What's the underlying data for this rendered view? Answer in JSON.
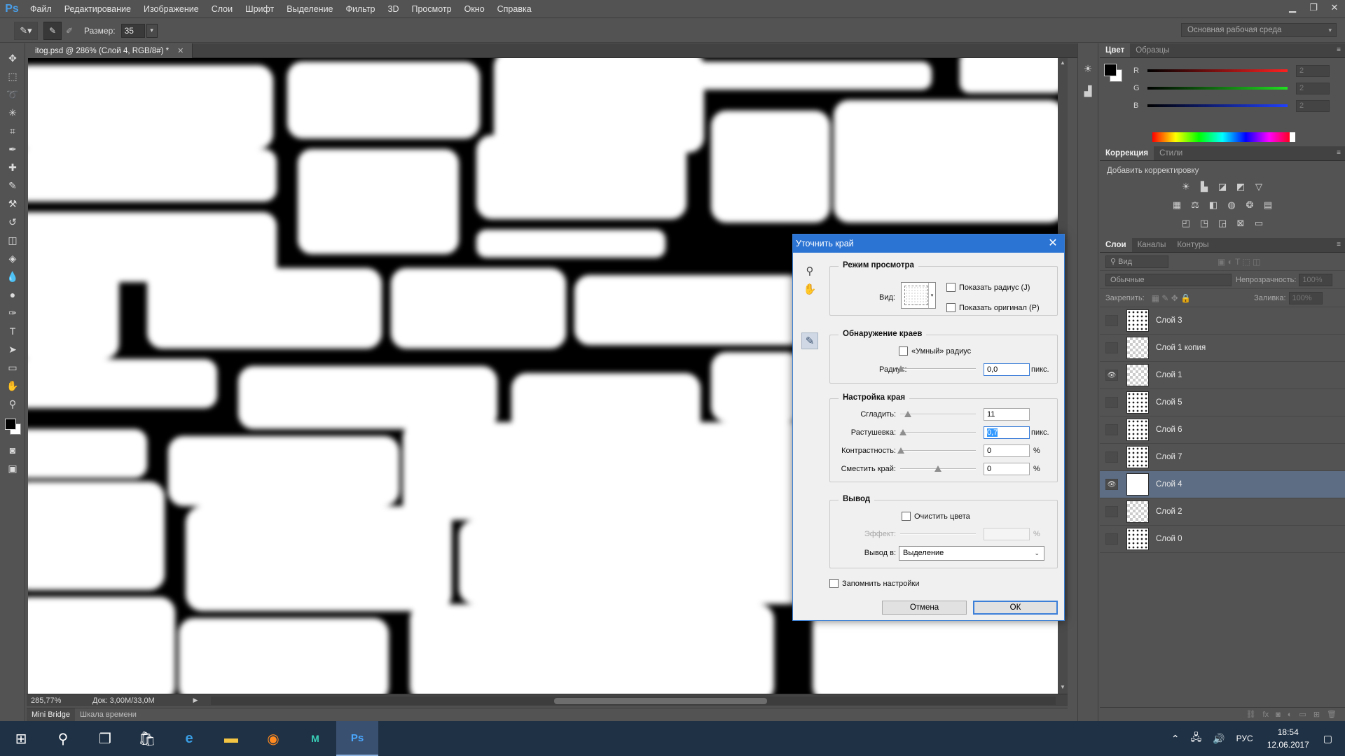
{
  "app": {
    "logo": "Ps"
  },
  "menu": [
    "Файл",
    "Редактирование",
    "Изображение",
    "Слои",
    "Шрифт",
    "Выделение",
    "Фильтр",
    "3D",
    "Просмотр",
    "Окно",
    "Справка"
  ],
  "options_bar": {
    "size_label": "Размер:",
    "size_value": "35",
    "workspace": "Основная рабочая среда"
  },
  "document": {
    "tab_title": "itog.psd @ 286% (Слой 4, RGB/8#) *",
    "zoom": "285,77%",
    "doc_info": "Док: 3,00M/33,0M"
  },
  "bottom_tabs": [
    "Mini Bridge",
    "Шкала времени"
  ],
  "color_panel": {
    "tabs": [
      "Цвет",
      "Образцы"
    ],
    "channels": [
      {
        "label": "R",
        "value": "2",
        "color": "#e62020"
      },
      {
        "label": "G",
        "value": "2",
        "color": "#20c020"
      },
      {
        "label": "B",
        "value": "2",
        "color": "#2040e0"
      }
    ]
  },
  "correction_panel": {
    "tabs": [
      "Коррекция",
      "Стили"
    ],
    "add_label": "Добавить корректировку"
  },
  "layers_panel": {
    "tabs": [
      "Слои",
      "Каналы",
      "Контуры"
    ],
    "filter_label": "Вид",
    "blend_mode": "Обычные",
    "opacity_label": "Непрозрачность:",
    "opacity_value": "100%",
    "lock_label": "Закрепить:",
    "fill_label": "Заливка:",
    "fill_value": "100%",
    "layers": [
      {
        "name": "Слой 3",
        "visible": false,
        "selected": false
      },
      {
        "name": "Слой 1 копия",
        "visible": false,
        "selected": false
      },
      {
        "name": "Слой 1",
        "visible": true,
        "selected": false
      },
      {
        "name": "Слой 5",
        "visible": false,
        "selected": false
      },
      {
        "name": "Слой 6",
        "visible": false,
        "selected": false
      },
      {
        "name": "Слой 7",
        "visible": false,
        "selected": false
      },
      {
        "name": "Слой 4",
        "visible": true,
        "selected": true
      },
      {
        "name": "Слой 2",
        "visible": false,
        "selected": false
      },
      {
        "name": "Слой 0",
        "visible": false,
        "selected": false
      }
    ]
  },
  "dialog": {
    "title": "Уточнить край",
    "view_mode": {
      "title": "Режим просмотра",
      "view_label": "Вид:",
      "show_radius": "Показать радиус (J)",
      "show_original": "Показать оригинал (P)"
    },
    "edge_detection": {
      "title": "Обнаружение краев",
      "smart_radius": "«Умный» радиус",
      "radius_label": "Радиус:",
      "radius_value": "0,0",
      "radius_unit": "пикс."
    },
    "adjust_edge": {
      "title": "Настройка края",
      "smooth_label": "Сгладить:",
      "smooth_value": "11",
      "feather_label": "Растушевка:",
      "feather_value": "0,7",
      "feather_unit": "пикс.",
      "contrast_label": "Контрастность:",
      "contrast_value": "0",
      "contrast_unit": "%",
      "shift_label": "Сместить край:",
      "shift_value": "0",
      "shift_unit": "%"
    },
    "output": {
      "title": "Вывод",
      "decontaminate": "Очистить цвета",
      "amount_label": "Эффект:",
      "amount_unit": "%",
      "output_to_label": "Вывод в:",
      "output_to_value": "Выделение"
    },
    "remember": "Запомнить настройки",
    "cancel": "Отмена",
    "ok": "ОК"
  },
  "taskbar": {
    "lang": "РУС",
    "time": "18:54",
    "date": "12.06.2017"
  }
}
